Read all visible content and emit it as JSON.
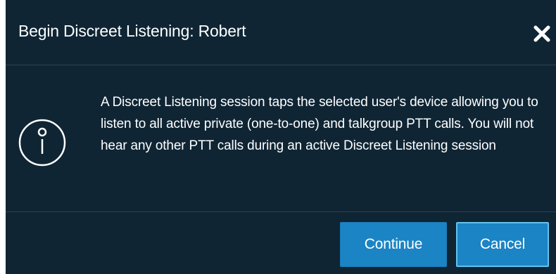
{
  "dialog": {
    "title": "Begin Discreet Listening: Robert",
    "close_icon": "close-icon",
    "info_icon": "info-icon",
    "message": "A Discreet Listening session taps the selected user's device allowing you to listen to all active private (one-to-one) and talkgroup PTT calls. You will not hear any other PTT calls during an active Discreet Listening session",
    "continue_label": "Continue",
    "cancel_label": "Cancel"
  },
  "colors": {
    "background": "#0f2534",
    "button": "#1b84c4",
    "focus_border": "#62c3f0",
    "text": "#ffffff"
  }
}
